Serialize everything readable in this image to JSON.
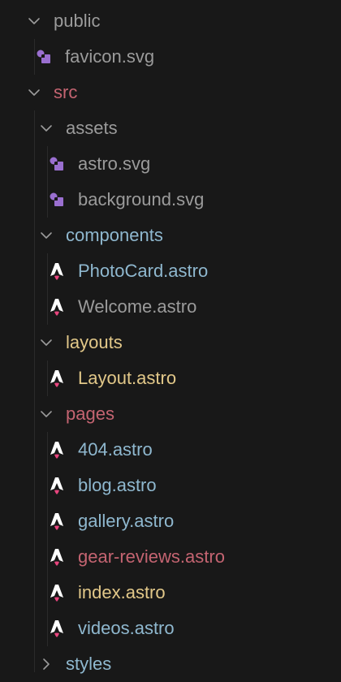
{
  "explorer": {
    "public": {
      "label": "public",
      "state": "expanded",
      "children": [
        {
          "label": "favicon.svg",
          "icon": "svg-file-icon"
        }
      ]
    },
    "src": {
      "label": "src",
      "state": "expanded",
      "folders": {
        "assets": {
          "label": "assets",
          "state": "expanded",
          "children": [
            {
              "label": "astro.svg",
              "icon": "svg-file-icon"
            },
            {
              "label": "background.svg",
              "icon": "svg-file-icon"
            }
          ]
        },
        "components": {
          "label": "components",
          "state": "expanded",
          "children": [
            {
              "label": "PhotoCard.astro",
              "icon": "astro-file-icon"
            },
            {
              "label": "Welcome.astro",
              "icon": "astro-file-icon"
            }
          ]
        },
        "layouts": {
          "label": "layouts",
          "state": "expanded",
          "children": [
            {
              "label": "Layout.astro",
              "icon": "astro-file-icon"
            }
          ]
        },
        "pages": {
          "label": "pages",
          "state": "expanded",
          "children": [
            {
              "label": "404.astro",
              "icon": "astro-file-icon"
            },
            {
              "label": "blog.astro",
              "icon": "astro-file-icon"
            },
            {
              "label": "gallery.astro",
              "icon": "astro-file-icon"
            },
            {
              "label": "gear-reviews.astro",
              "icon": "astro-file-icon"
            },
            {
              "label": "index.astro",
              "icon": "astro-file-icon"
            },
            {
              "label": "videos.astro",
              "icon": "astro-file-icon"
            }
          ]
        },
        "styles": {
          "label": "styles",
          "state": "collapsed"
        }
      }
    }
  },
  "colors": {
    "background": "#181818",
    "muted": "#9b9b9b",
    "red": "#c46471",
    "blue": "#8fb8cf",
    "yellow": "#e2c889",
    "default": "#bdbdbd",
    "svg_icon": "#9a6fd0",
    "astro_icon_body": "#ffffff",
    "astro_icon_flame": "#e8457e"
  }
}
